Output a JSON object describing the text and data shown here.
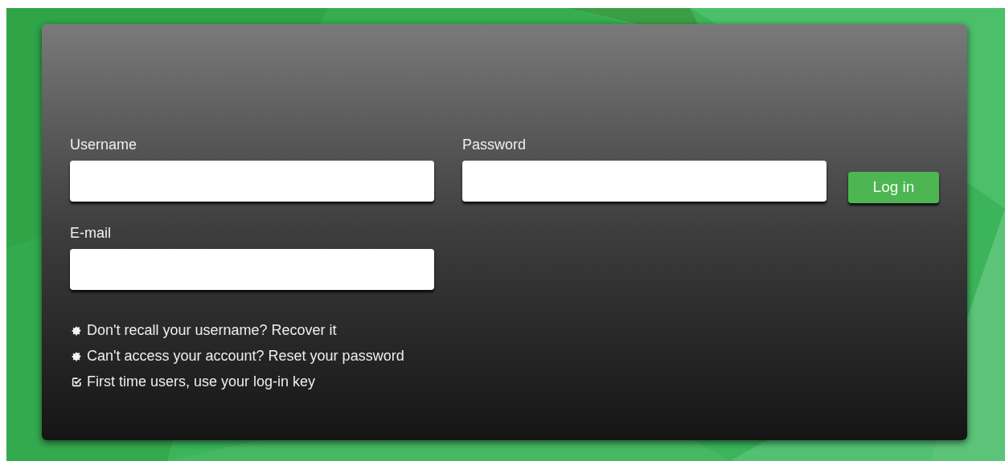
{
  "form": {
    "fields": [
      {
        "label": "Username"
      },
      {
        "label": "Password"
      },
      {
        "label": "E-mail"
      }
    ],
    "submit": "Log in"
  },
  "help_links": [
    {
      "kind": "gear",
      "text": "Don't recall your username?",
      "link": "Recover it"
    },
    {
      "kind": "gear",
      "text": "Can't access your account?",
      "link": "Reset your password"
    },
    {
      "kind": "check",
      "text": "First time users, use your log-in key"
    }
  ]
}
